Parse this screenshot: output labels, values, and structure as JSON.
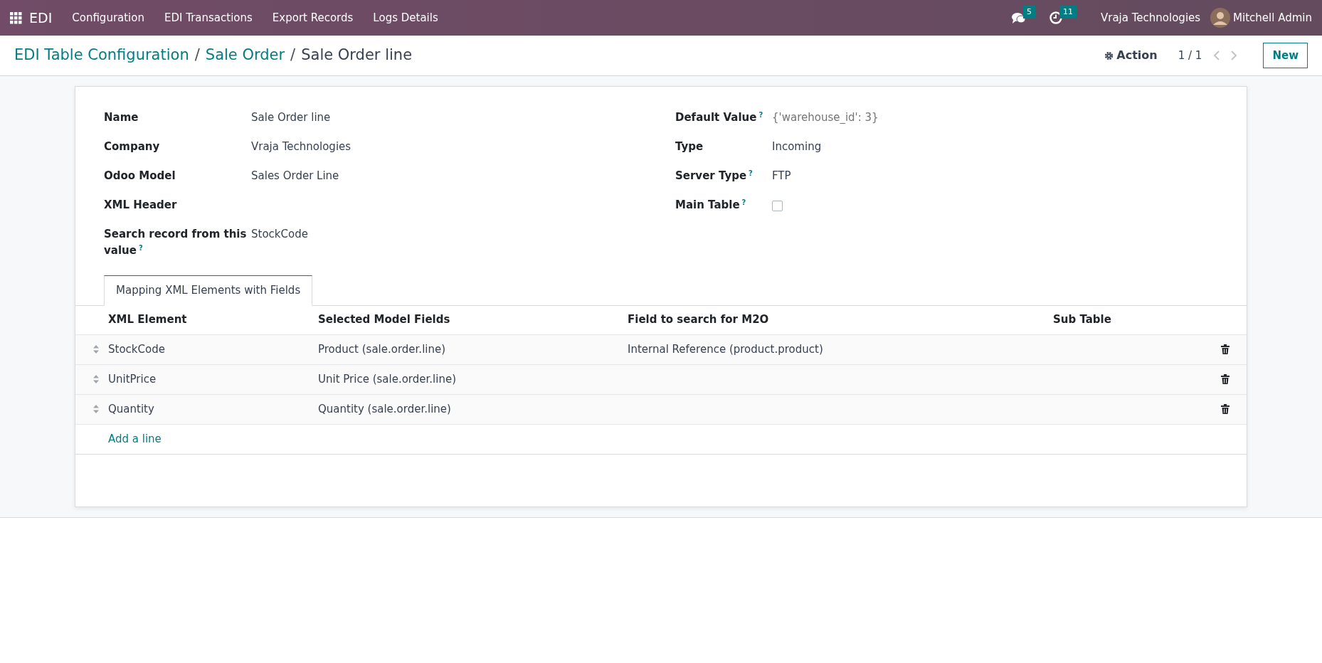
{
  "navbar": {
    "app": "EDI",
    "menu": [
      "Configuration",
      "EDI Transactions",
      "Export Records",
      "Logs Details"
    ],
    "messages_count": "5",
    "activities_count": "11",
    "company": "Vraja Technologies",
    "user": "Mitchell Admin"
  },
  "breadcrumb": [
    {
      "label": "EDI Table Configuration",
      "link": true
    },
    {
      "separator": "/",
      "label": "Sale Order",
      "link": true
    },
    {
      "separator": "/",
      "label": "Sale Order line",
      "link": false
    }
  ],
  "control_panel": {
    "action": "Action",
    "pager": "1 / 1",
    "new_button": "New"
  },
  "left_fields": [
    {
      "label": "Name",
      "kind": "text",
      "value": "Sale Order line"
    },
    {
      "label": "Company",
      "kind": "text",
      "value": "Vraja Technologies"
    },
    {
      "label": "Odoo Model",
      "kind": "text",
      "value": "Sales Order Line"
    },
    {
      "label": "XML Header",
      "kind": "text"
    },
    {
      "label": "Search record from this value$^{?}$",
      "kind": "text",
      "value": "StockCode"
    }
  ],
  "right_fields": [
    {
      "label": "Default Value$^{?}$",
      "kind": "text",
      "placeholder": "{'warehouse_id': 3}"
    },
    {
      "label": "Type",
      "kind": "text",
      "value": "Incoming"
    },
    {
      "label": "Server Type$^{?}$",
      "kind": "text",
      "value": "FTP"
    },
    {
      "label": "Main Table$^{?}$",
      "kind": "checkbox",
      "checked": false
    }
  ],
  "tabs": [
    {
      "label": "Mapping XML Elements with Fields",
      "selected": true
    }
  ],
  "table": {
    "columns": [
      "XML Element",
      "Selected Model Fields",
      "Field to search for M2O",
      "Sub Table"
    ],
    "rows": [
      [
        "StockCode",
        "Product (sale.order.line)",
        "Internal Reference (product.product)"
      ],
      [
        "UnitPrice",
        "Unit Price (sale.order.line)"
      ],
      [
        "Quantity",
        "Quantity (sale.order.line)"
      ]
    ],
    "add_line": "Add a line"
  }
}
